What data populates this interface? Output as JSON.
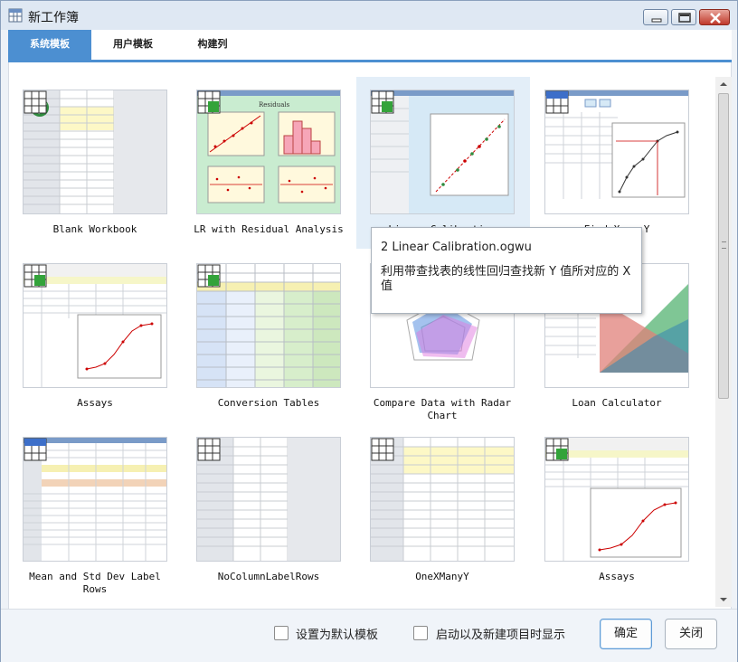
{
  "window": {
    "title": "新工作簿"
  },
  "tabs": [
    {
      "label": "系统模板",
      "active": true
    },
    {
      "label": "用户模板",
      "active": false
    },
    {
      "label": "构建列",
      "active": false
    }
  ],
  "templates": [
    {
      "label": "Blank Workbook",
      "thumb": "blank-wb"
    },
    {
      "label": "LR with Residual Analysis",
      "thumb": "residual"
    },
    {
      "label": "Linear Calibration",
      "thumb": "calib"
    },
    {
      "label": "Find X or Y",
      "thumb": "findxy"
    },
    {
      "label": "Assays",
      "thumb": "assays"
    },
    {
      "label": "Conversion Tables",
      "thumb": "conversion"
    },
    {
      "label": "Compare Data with Radar Chart",
      "thumb": "radar"
    },
    {
      "label": "Loan Calculator",
      "thumb": "loan"
    },
    {
      "label": "Mean and Std Dev Label Rows",
      "thumb": "meanstd"
    },
    {
      "label": "NoColumnLabelRows",
      "thumb": "nocol"
    },
    {
      "label": "OneXManyY",
      "thumb": "onex"
    },
    {
      "label": "Assays",
      "thumb": "assays"
    }
  ],
  "tooltip": {
    "title": "2 Linear Calibration.ogwu",
    "description": "利用带查找表的线性回归查找新 Y 值所对应的 X 值"
  },
  "footer": {
    "checkbox_default": "设置为默认模板",
    "checkbox_startup": "启动以及新建项目时显示",
    "ok": "确定",
    "close": "关闭"
  },
  "colors": {
    "accent": "#4c8fd1",
    "selected": "#e3eef8"
  }
}
